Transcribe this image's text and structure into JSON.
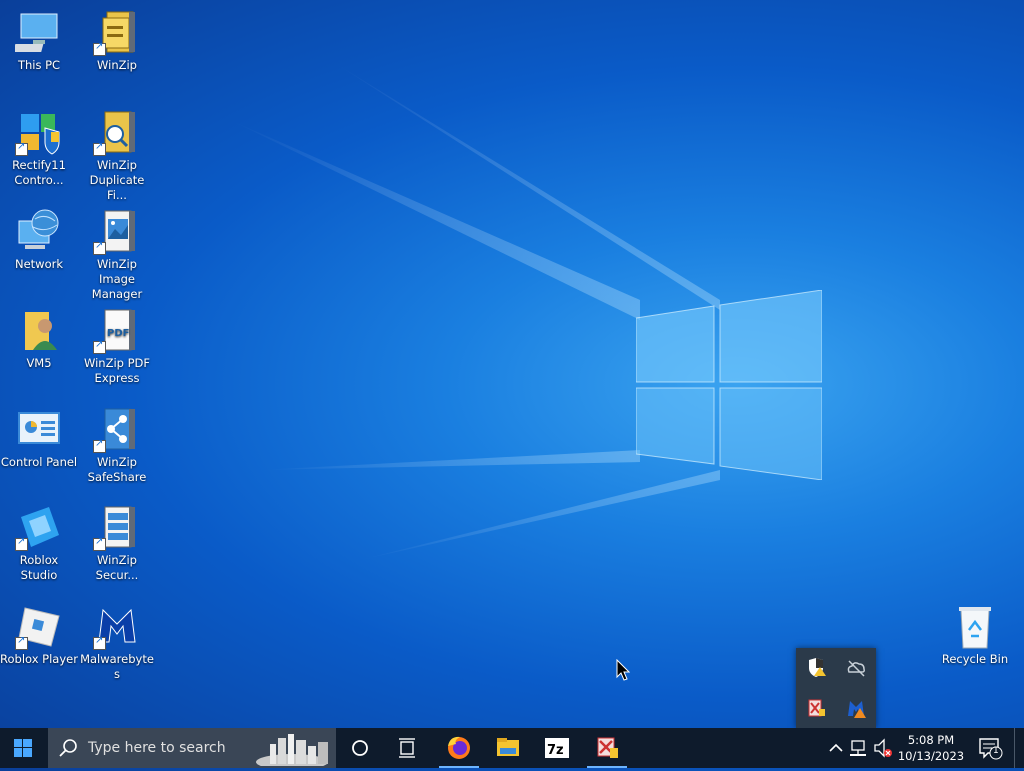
{
  "desktop": {
    "icons": [
      {
        "label": "This PC",
        "icon": "this-pc-icon"
      },
      {
        "label": "WinZip",
        "icon": "winzip-icon"
      },
      {
        "label": "Rectify11 Contro...",
        "icon": "rectify11-control-icon"
      },
      {
        "label": "WinZip Duplicate Fi...",
        "icon": "winzip-duplicate-files-icon"
      },
      {
        "label": "Network",
        "icon": "network-icon"
      },
      {
        "label": "WinZip Image Manager",
        "icon": "winzip-image-manager-icon"
      },
      {
        "label": "VM5",
        "icon": "user-folder-icon"
      },
      {
        "label": "WinZip PDF Express",
        "icon": "winzip-pdf-express-icon"
      },
      {
        "label": "Control Panel",
        "icon": "control-panel-icon"
      },
      {
        "label": "WinZip SafeShare",
        "icon": "winzip-safeshare-icon"
      },
      {
        "label": "Roblox Studio",
        "icon": "roblox-studio-icon"
      },
      {
        "label": "WinZip Secur...",
        "icon": "winzip-secure-backup-icon"
      },
      {
        "label": "Roblox Player",
        "icon": "roblox-player-icon"
      },
      {
        "label": "Malwarebytes",
        "icon": "malwarebytes-icon"
      },
      {
        "label": "Recycle Bin",
        "icon": "recycle-bin-icon"
      }
    ]
  },
  "tray_popup": {
    "icons": [
      "security-warning-icon",
      "onedrive-offline-icon",
      "winzip-tray-icon",
      "malwarebytes-warning-icon"
    ]
  },
  "taskbar": {
    "search_placeholder": "Type here to search",
    "pinned": [
      "firefox-icon",
      "file-explorer-icon",
      "7zip-icon",
      "winzip-app-icon"
    ],
    "clock_time": "5:08 PM",
    "clock_date": "10/13/2023",
    "notification_count": "1"
  },
  "colors": {
    "taskbar_bg": "#0e1b2c",
    "search_bg": "#3a4656",
    "accent": "#6cb4ff"
  }
}
